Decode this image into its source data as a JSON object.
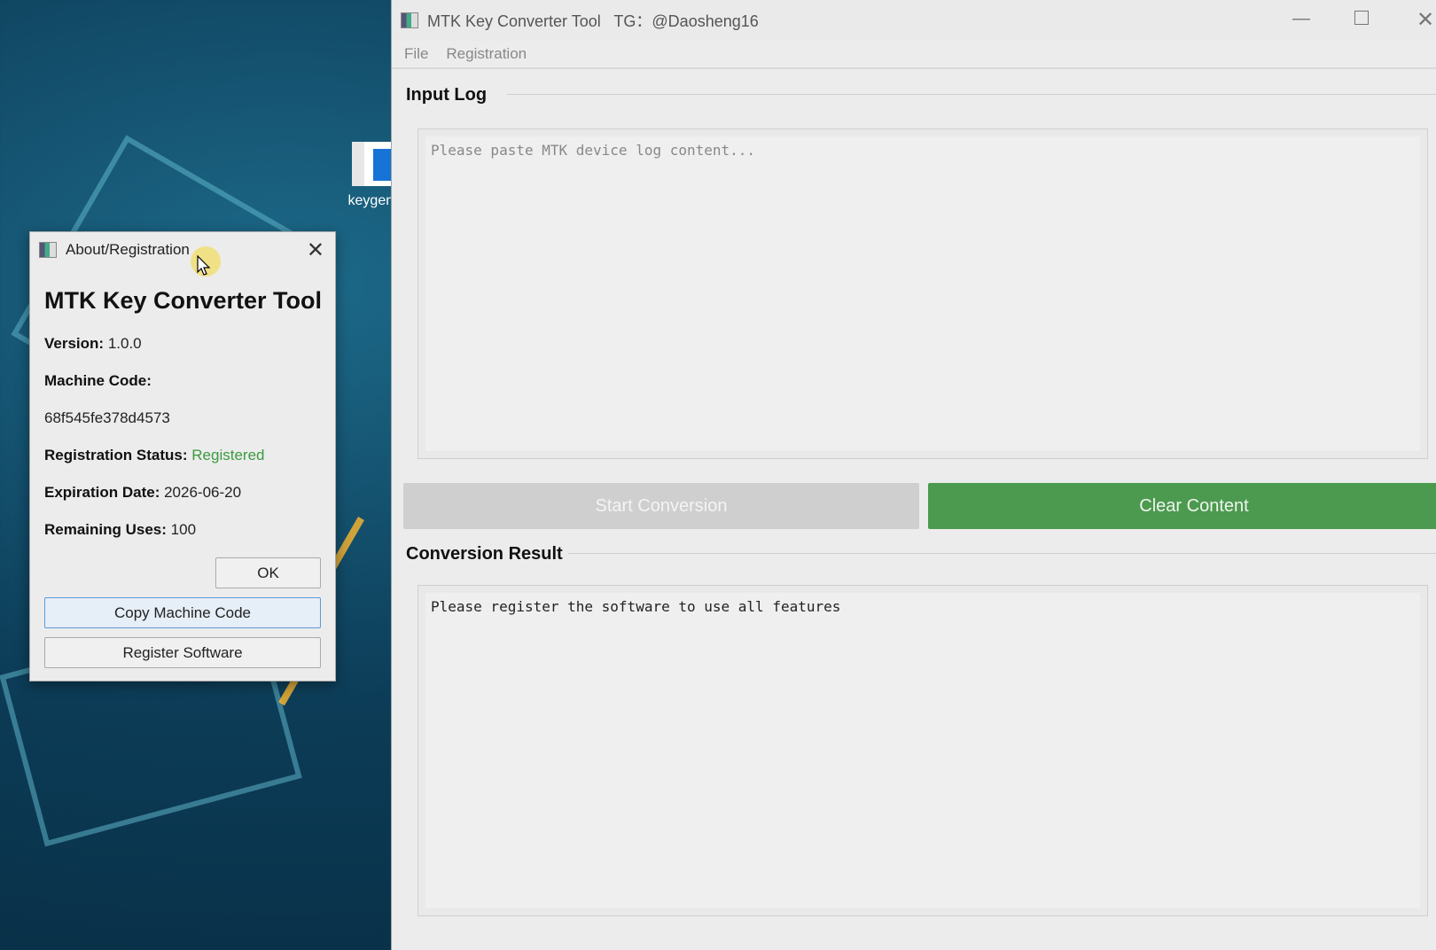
{
  "desktop": {
    "icon_label": "keygen-"
  },
  "main_window": {
    "title": "MTK Key Converter Tool   TG：@Daosheng16",
    "menu": [
      "File",
      "Registration"
    ],
    "input_group": {
      "title": "Input Log",
      "placeholder": "Please paste MTK device log content..."
    },
    "buttons": {
      "start": "Start Conversion",
      "clear": "Clear Content"
    },
    "result_group": {
      "title": "Conversion Result",
      "text": "Please register the software to use all features"
    },
    "colors": {
      "clear_button": "#4c9a4f",
      "start_button_disabled": "#cfcfcf"
    }
  },
  "dialog": {
    "title": "About/Registration",
    "heading": "MTK Key Converter Tool",
    "version_label": "Version:",
    "version": "1.0.0",
    "machine_code_label": "Machine Code:",
    "machine_code": "68f545fe378d4573",
    "status_label": "Registration Status:",
    "status": "Registered",
    "expiration_label": "Expiration Date:",
    "expiration": "2026-06-20",
    "uses_label": "Remaining Uses:",
    "uses": "100",
    "ok": "OK",
    "copy": "Copy Machine Code",
    "register": "Register Software",
    "colors": {
      "status": "#3a9a3e"
    }
  }
}
